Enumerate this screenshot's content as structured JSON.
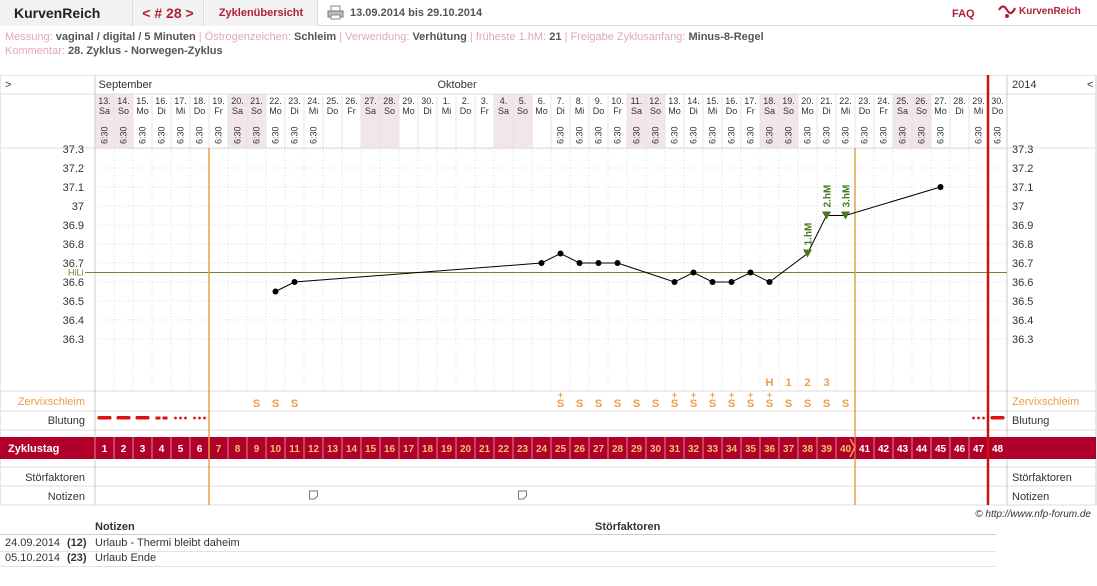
{
  "header": {
    "app_title": "KurvenReich",
    "cycle_nav": "< # 28 >",
    "overview": "Zyklenübersicht",
    "date_range": "13.09.2014 bis 29.10.2014",
    "faq": "FAQ",
    "logo": "KurvenReich"
  },
  "info": {
    "messung_label": "Messung:",
    "messung_value": "vaginal / digital / 5 Minuten",
    "oestrogen_label": "Östrogenzeichen:",
    "oestrogen_value": "Schleim",
    "verwendung_label": "Verwendung:",
    "verwendung_value": "Verhütung",
    "fhm_label": "früheste 1.hM:",
    "fhm_value": "21",
    "freigabe_label": "Freigabe Zyklusanfang:",
    "freigabe_value": "Minus-8-Regel",
    "kommentar_label": "Kommentar:",
    "kommentar_value": "28. Zyklus - Norwegen-Zyklus"
  },
  "chart_data": {
    "type": "line",
    "month_labels": [
      "September",
      "Oktober"
    ],
    "year_label": "2014",
    "nav_left": ">",
    "nav_right": "<",
    "day_numbers": [
      "13.",
      "14.",
      "15.",
      "16.",
      "17.",
      "18.",
      "19.",
      "20.",
      "21.",
      "22.",
      "23.",
      "24.",
      "25.",
      "26.",
      "27.",
      "28.",
      "29.",
      "30.",
      "1.",
      "2.",
      "3.",
      "4.",
      "5.",
      "6.",
      "7.",
      "8.",
      "9.",
      "10.",
      "11.",
      "12.",
      "13.",
      "14.",
      "15.",
      "16.",
      "17.",
      "18.",
      "19.",
      "20.",
      "21.",
      "22.",
      "23.",
      "24.",
      "25.",
      "26.",
      "27.",
      "28.",
      "29.",
      "30."
    ],
    "weekdays": [
      "Sa",
      "So",
      "Mo",
      "Di",
      "Mi",
      "Do",
      "Fr",
      "Sa",
      "So",
      "Mo",
      "Di",
      "Mi",
      "Do",
      "Fr",
      "Sa",
      "So",
      "Mo",
      "Di",
      "Mi",
      "Do",
      "Fr",
      "Sa",
      "So",
      "Mo",
      "Di",
      "Mi",
      "Do",
      "Fr",
      "Sa",
      "So",
      "Mo",
      "Di",
      "Mi",
      "Do",
      "Fr",
      "Sa",
      "So",
      "Mo",
      "Di",
      "Mi",
      "Do",
      "Fr",
      "Sa",
      "So",
      "Mo",
      "Di",
      "Mi",
      "Do"
    ],
    "cycle_days": [
      1,
      2,
      3,
      4,
      5,
      6,
      7,
      8,
      9,
      10,
      11,
      12,
      13,
      14,
      15,
      16,
      17,
      18,
      19,
      20,
      21,
      22,
      23,
      24,
      25,
      26,
      27,
      28,
      29,
      30,
      31,
      32,
      33,
      34,
      35,
      36,
      37,
      38,
      39,
      40,
      41,
      42,
      43,
      44,
      45,
      46,
      47,
      48
    ],
    "time_label": "6:30",
    "time_days": [
      1,
      2,
      3,
      4,
      5,
      6,
      7,
      8,
      9,
      10,
      11,
      12,
      25,
      26,
      27,
      28,
      29,
      30,
      31,
      32,
      33,
      34,
      35,
      36,
      37,
      38,
      39,
      40,
      41,
      42,
      43,
      44,
      45,
      47,
      48
    ],
    "y_ticks": [
      "37.3",
      "37.2",
      "37.1",
      "37",
      "36.9",
      "36.8",
      "36.7",
      "36.6",
      "36.5",
      "36.4",
      "36.3"
    ],
    "ylim": [
      36.3,
      37.3
    ],
    "hili_label": "HiLi",
    "hili_value": 36.65,
    "temperatures": [
      {
        "day": 10,
        "temp": 36.55
      },
      {
        "day": 11,
        "temp": 36.6
      },
      {
        "day": 24,
        "temp": 36.7
      },
      {
        "day": 25,
        "temp": 36.75
      },
      {
        "day": 26,
        "temp": 36.7
      },
      {
        "day": 27,
        "temp": 36.7
      },
      {
        "day": 28,
        "temp": 36.7
      },
      {
        "day": 31,
        "temp": 36.6
      },
      {
        "day": 32,
        "temp": 36.65
      },
      {
        "day": 33,
        "temp": 36.6
      },
      {
        "day": 34,
        "temp": 36.6
      },
      {
        "day": 35,
        "temp": 36.65
      },
      {
        "day": 36,
        "temp": 36.6
      },
      {
        "day": 38,
        "temp": 36.75
      },
      {
        "day": 39,
        "temp": 36.95
      },
      {
        "day": 40,
        "temp": 36.95
      },
      {
        "day": 45,
        "temp": 37.1
      }
    ],
    "higher_measurements": [
      {
        "day": 38,
        "label": "1.hM"
      },
      {
        "day": 39,
        "label": "2.hM"
      },
      {
        "day": 40,
        "label": "3.hM"
      }
    ],
    "cervix_label": "Zervixschleim",
    "cervix": [
      {
        "day": 9,
        "sym": "S"
      },
      {
        "day": 10,
        "sym": "S"
      },
      {
        "day": 11,
        "sym": "S"
      },
      {
        "day": 25,
        "sym": "S+"
      },
      {
        "day": 26,
        "sym": "S"
      },
      {
        "day": 27,
        "sym": "S"
      },
      {
        "day": 28,
        "sym": "S"
      },
      {
        "day": 29,
        "sym": "S"
      },
      {
        "day": 30,
        "sym": "S"
      },
      {
        "day": 31,
        "sym": "S+"
      },
      {
        "day": 32,
        "sym": "S+"
      },
      {
        "day": 33,
        "sym": "S+"
      },
      {
        "day": 34,
        "sym": "S+"
      },
      {
        "day": 35,
        "sym": "S+"
      },
      {
        "day": 36,
        "sym": "S+"
      },
      {
        "day": 37,
        "sym": "S"
      },
      {
        "day": 38,
        "sym": "S"
      },
      {
        "day": 39,
        "sym": "S"
      },
      {
        "day": 40,
        "sym": "S"
      }
    ],
    "cervix_peak_marks": [
      {
        "day": 36,
        "text": "H"
      },
      {
        "day": 37,
        "text": "1"
      },
      {
        "day": 38,
        "text": "2"
      },
      {
        "day": 39,
        "text": "3"
      }
    ],
    "blutung_label": "Blutung",
    "bleeding": [
      {
        "day": 1,
        "level": "heavy"
      },
      {
        "day": 2,
        "level": "heavy"
      },
      {
        "day": 3,
        "level": "heavy"
      },
      {
        "day": 4,
        "level": "medium"
      },
      {
        "day": 5,
        "level": "light"
      },
      {
        "day": 6,
        "level": "light"
      },
      {
        "day": 47,
        "level": "light"
      },
      {
        "day": 48,
        "level": "heavy"
      }
    ],
    "zyklustag_label": "Zyklustag",
    "stoerfaktoren_label": "Störfaktoren",
    "notizen_label": "Notizen",
    "note_days": [
      12,
      23
    ],
    "infertile_start_day": 7,
    "infertile_end_day": 40,
    "cycle_end_day": 48,
    "colors": {
      "red": "#b0002a",
      "orange": "#e8a04a",
      "line": "#000000",
      "hili": "#6a8a30",
      "hm": "#4a7a20",
      "shade": "#f3e6ea",
      "grid": "#dddddd"
    }
  },
  "notes_table": {
    "notes_header": "Notizen",
    "stoer_header": "Störfaktoren",
    "rows": [
      {
        "date": "24.09.2014",
        "day": "(12)",
        "text": "Urlaub - Thermi bleibt daheim"
      },
      {
        "date": "05.10.2014",
        "day": "(23)",
        "text": "Urlaub Ende"
      }
    ]
  },
  "copyright": "© http://www.nfp-forum.de"
}
